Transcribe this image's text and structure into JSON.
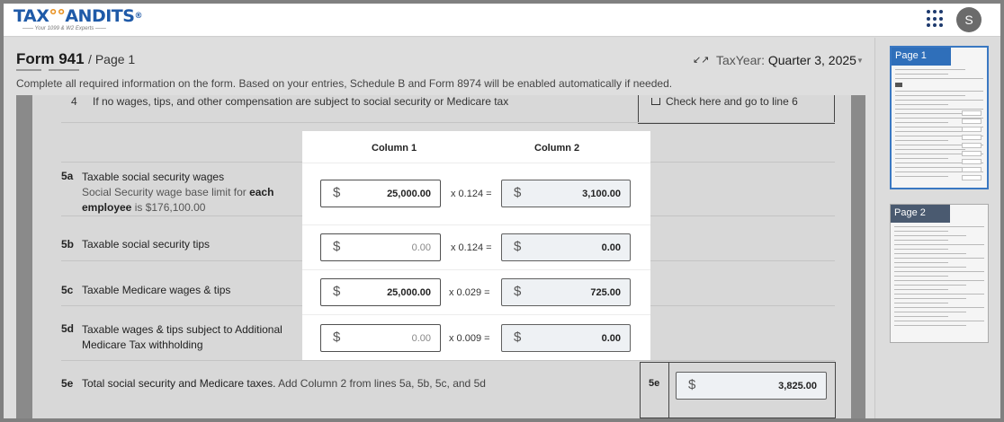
{
  "app": {
    "logo_text_1": "TAX",
    "logo_text_owl": "°°",
    "logo_text_2": "ANDITS",
    "logo_reg": "®",
    "logo_tagline": "—— Your 1099 & W2 Experts ——",
    "avatar_initial": "S"
  },
  "header": {
    "form_title": "Form 941",
    "page_label": "/ Page 1",
    "taxyear_label": "TaxYear:",
    "taxyear_value": "Quarter 3, 2025",
    "instructions": "Complete all required information on the form. Based on your entries, Schedule B and Form 8974 will be enabled automatically if needed."
  },
  "line4": {
    "number": "4",
    "text": "If no wages, tips, and other compensation are subject to social security or Medicare tax",
    "check_label": "Check here and go to line 6"
  },
  "columns": {
    "col1": "Column 1",
    "col2": "Column 2"
  },
  "rows": [
    {
      "num": "5a",
      "label": "Taxable social security wages",
      "sub_1": "Social Security wage base limit for ",
      "sub_bold_1": "each",
      "sub_bold_2": "employee",
      "sub_2": " is $176,100.00",
      "col1": "25,000.00",
      "mult": "x 0.124 =",
      "col2": "3,100.00"
    },
    {
      "num": "5b",
      "label": "Taxable social security tips",
      "col1": "0.00",
      "mult": "x 0.124 =",
      "col2": "0.00"
    },
    {
      "num": "5c",
      "label": "Taxable Medicare wages & tips",
      "col1": "25,000.00",
      "mult": "x 0.029 =",
      "col2": "725.00"
    },
    {
      "num": "5d",
      "label_1": "Taxable wages & tips subject to Additional",
      "label_2": "Medicare Tax withholding",
      "col1": "0.00",
      "mult": "x 0.009 =",
      "col2": "0.00"
    }
  ],
  "line5e": {
    "num": "5e",
    "label_bold": "Total social security and Medicare taxes.",
    "label_rest": " Add Column 2 from lines 5a, 5b, 5c, and 5d",
    "box_label": "5e",
    "value": "3,825.00"
  },
  "currency_symbol": "$",
  "thumbnails": [
    {
      "label": "Page 1"
    },
    {
      "label": "Page 2"
    }
  ]
}
